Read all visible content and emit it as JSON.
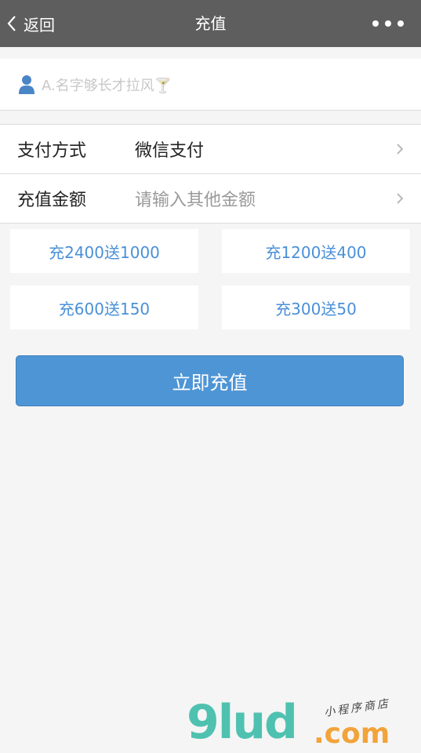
{
  "nav": {
    "back_label": "返回",
    "title": "充值",
    "more_icon": "more-dots-icon"
  },
  "user": {
    "icon": "user-icon",
    "name": "A.名字够长才拉风🍸"
  },
  "form": {
    "payment": {
      "label": "支付方式",
      "value": "微信支付"
    },
    "amount": {
      "label": "充值金额",
      "placeholder": "请输入其他金额"
    }
  },
  "amounts": [
    "充2400送1000",
    "充1200送400",
    "充600送150",
    "充300送50"
  ],
  "submit_label": "立即充值",
  "watermark": {
    "main": "9lud",
    "suffix": ".com",
    "tagline": "小程序商店"
  },
  "colors": {
    "nav_bg": "#5e5e5e",
    "accent": "#4e95d5",
    "amount_text": "#4a90d9"
  }
}
